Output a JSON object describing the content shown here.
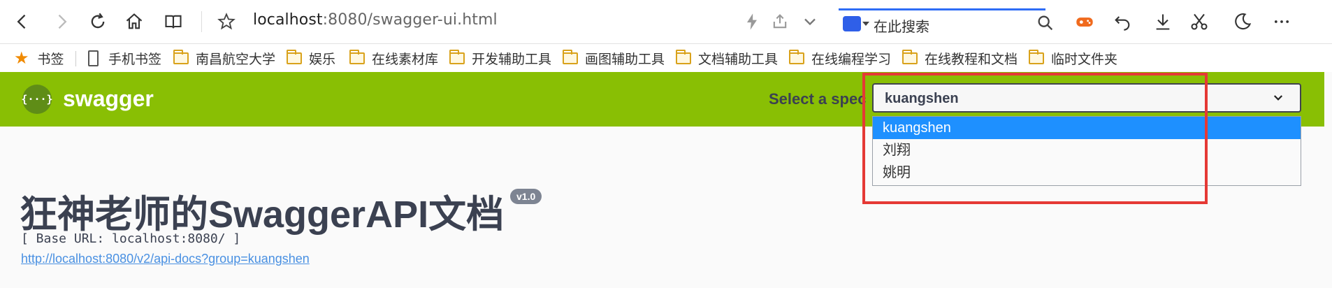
{
  "browser": {
    "url_host": "localhost",
    "url_rest": ":8080/swagger-ui.html",
    "search_placeholder": "在此搜索",
    "icons": [
      "back-icon",
      "forward-icon",
      "reload-icon",
      "home-icon",
      "reader-icon",
      "star-icon",
      "lightning-icon",
      "share-icon",
      "chevron-down-icon",
      "search-icon",
      "game-icon",
      "undo-icon",
      "download-icon",
      "scissors-icon",
      "moon-icon",
      "more-icon"
    ]
  },
  "bookmarks": [
    {
      "label": "书签",
      "icon": "star-icon"
    },
    {
      "label": "手机书签",
      "icon": "phone-icon"
    },
    {
      "label": "南昌航空大学",
      "icon": "folder-icon"
    },
    {
      "label": "娱乐",
      "icon": "folder-icon"
    },
    {
      "label": "在线素材库",
      "icon": "folder-icon"
    },
    {
      "label": "开发辅助工具",
      "icon": "folder-icon"
    },
    {
      "label": "画图辅助工具",
      "icon": "folder-icon"
    },
    {
      "label": "文档辅助工具",
      "icon": "folder-icon"
    },
    {
      "label": "在线编程学习",
      "icon": "folder-icon"
    },
    {
      "label": "在线教程和文档",
      "icon": "folder-icon"
    },
    {
      "label": "临时文件夹",
      "icon": "folder-icon"
    }
  ],
  "swagger": {
    "brand": "swagger",
    "logo_text": "{···}",
    "spec_label": "Select a spec",
    "selected_spec": "kuangshen",
    "spec_options": [
      "kuangshen",
      "刘翔",
      "姚明"
    ]
  },
  "info": {
    "title": "狂神老师的SwaggerAPI文档",
    "version": "v1.0",
    "base_url": "[ Base URL: localhost:8080/ ]",
    "api_docs_link": "http://localhost:8080/v2/api-docs?group=kuangshen"
  },
  "colors": {
    "header_green": "#89bf04",
    "selected_option": "#1e90ff",
    "annotation_red": "#e53935",
    "link_blue": "#4990e2"
  }
}
